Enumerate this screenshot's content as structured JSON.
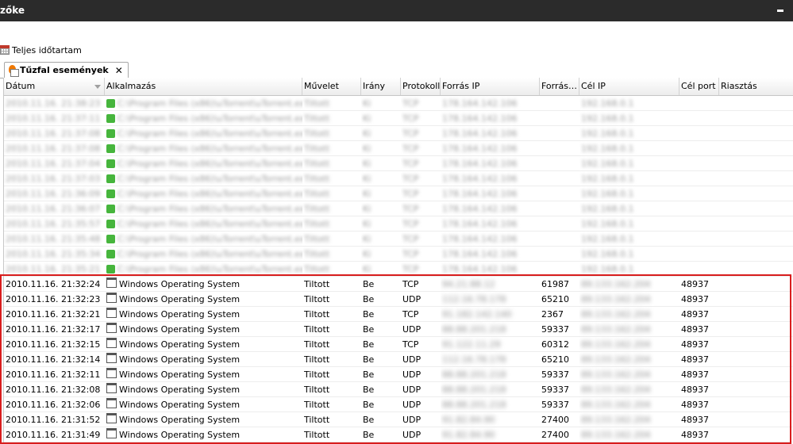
{
  "window": {
    "title": "zőke"
  },
  "period": {
    "label": "Teljes időtartam",
    "icon": "calendar-icon"
  },
  "tab": {
    "label": "Tűzfal események",
    "icon": "firewall-icon",
    "close": "✕"
  },
  "columns": [
    "Dátum",
    "Alkalmazás",
    "Művelet",
    "Irány",
    "Protokoll",
    "Forrás IP",
    "Forrás…",
    "Cél IP",
    "Cél port",
    "Riasztás"
  ],
  "blurred_rows": [
    {
      "date": "2010.11.16. 21:38:23",
      "app": "C:\\Program Files (x86)\\uTorrent\\uTorrent.exe",
      "action": "Tiltott",
      "dir": "Ki",
      "proto": "TCP",
      "src": "178.164.142.106",
      "port": "",
      "dst": "192.168.0.1",
      "dport": ""
    },
    {
      "date": "2010.11.16. 21:37:11",
      "app": "C:\\Program Files (x86)\\uTorrent\\uTorrent.exe",
      "action": "Tiltott",
      "dir": "Ki",
      "proto": "TCP",
      "src": "178.164.142.106",
      "port": "",
      "dst": "192.168.0.1",
      "dport": ""
    },
    {
      "date": "2010.11.16. 21:37:08",
      "app": "C:\\Program Files (x86)\\uTorrent\\uTorrent.exe",
      "action": "Tiltott",
      "dir": "Ki",
      "proto": "TCP",
      "src": "178.164.142.106",
      "port": "",
      "dst": "192.168.0.1",
      "dport": ""
    },
    {
      "date": "2010.11.16. 21:37:08",
      "app": "C:\\Program Files (x86)\\uTorrent\\uTorrent.exe",
      "action": "Tiltott",
      "dir": "Ki",
      "proto": "TCP",
      "src": "178.164.142.106",
      "port": "",
      "dst": "192.168.0.1",
      "dport": ""
    },
    {
      "date": "2010.11.16. 21:37:04",
      "app": "C:\\Program Files (x86)\\uTorrent\\uTorrent.exe",
      "action": "Tiltott",
      "dir": "Ki",
      "proto": "TCP",
      "src": "178.164.142.106",
      "port": "",
      "dst": "192.168.0.1",
      "dport": ""
    },
    {
      "date": "2010.11.16. 21:37:03",
      "app": "C:\\Program Files (x86)\\uTorrent\\uTorrent.exe",
      "action": "Tiltott",
      "dir": "Ki",
      "proto": "TCP",
      "src": "178.164.142.106",
      "port": "",
      "dst": "192.168.0.1",
      "dport": ""
    },
    {
      "date": "2010.11.16. 21:36:09",
      "app": "C:\\Program Files (x86)\\uTorrent\\uTorrent.exe",
      "action": "Tiltott",
      "dir": "Ki",
      "proto": "TCP",
      "src": "178.164.142.106",
      "port": "",
      "dst": "192.168.0.1",
      "dport": ""
    },
    {
      "date": "2010.11.16. 21:36:07",
      "app": "C:\\Program Files (x86)\\uTorrent\\uTorrent.exe",
      "action": "Tiltott",
      "dir": "Ki",
      "proto": "TCP",
      "src": "178.164.142.106",
      "port": "",
      "dst": "192.168.0.1",
      "dport": ""
    },
    {
      "date": "2010.11.16. 21:35:57",
      "app": "C:\\Program Files (x86)\\uTorrent\\uTorrent.exe",
      "action": "Tiltott",
      "dir": "Ki",
      "proto": "TCP",
      "src": "178.164.142.106",
      "port": "",
      "dst": "192.168.0.1",
      "dport": ""
    },
    {
      "date": "2010.11.16. 21:35:48",
      "app": "C:\\Program Files (x86)\\uTorrent\\uTorrent.exe",
      "action": "Tiltott",
      "dir": "Ki",
      "proto": "TCP",
      "src": "178.164.142.106",
      "port": "",
      "dst": "192.168.0.1",
      "dport": ""
    },
    {
      "date": "2010.11.16. 21:35:34",
      "app": "C:\\Program Files (x86)\\uTorrent\\uTorrent.exe",
      "action": "Tiltott",
      "dir": "Ki",
      "proto": "TCP",
      "src": "178.164.142.106",
      "port": "",
      "dst": "192.168.0.1",
      "dport": ""
    },
    {
      "date": "2010.11.16. 21:35:21",
      "app": "C:\\Program Files (x86)\\uTorrent\\uTorrent.exe",
      "action": "Tiltott",
      "dir": "Ki",
      "proto": "TCP",
      "src": "178.164.142.106",
      "port": "",
      "dst": "192.168.0.1",
      "dport": ""
    }
  ],
  "rows": [
    {
      "date": "2010.11.16. 21:32:24",
      "app": "Windows Operating System",
      "action": "Tiltott",
      "dir": "Be",
      "proto": "TCP",
      "src": "94.21.88.12",
      "port": "61987",
      "dst": "89.133.162.204",
      "dport": "48937"
    },
    {
      "date": "2010.11.16. 21:32:23",
      "app": "Windows Operating System",
      "action": "Tiltott",
      "dir": "Be",
      "proto": "UDP",
      "src": "112.16.78.178",
      "port": "65210",
      "dst": "89.133.162.204",
      "dport": "48937"
    },
    {
      "date": "2010.11.16. 21:32:21",
      "app": "Windows Operating System",
      "action": "Tiltott",
      "dir": "Be",
      "proto": "TCP",
      "src": "91.182.142.140",
      "port": "2367",
      "dst": "89.133.162.204",
      "dport": "48937"
    },
    {
      "date": "2010.11.16. 21:32:17",
      "app": "Windows Operating System",
      "action": "Tiltott",
      "dir": "Be",
      "proto": "UDP",
      "src": "88.88.201.218",
      "port": "59337",
      "dst": "89.133.162.204",
      "dport": "48937"
    },
    {
      "date": "2010.11.16. 21:32:15",
      "app": "Windows Operating System",
      "action": "Tiltott",
      "dir": "Be",
      "proto": "TCP",
      "src": "91.122.11.29",
      "port": "60312",
      "dst": "89.133.162.204",
      "dport": "48937"
    },
    {
      "date": "2010.11.16. 21:32:14",
      "app": "Windows Operating System",
      "action": "Tiltott",
      "dir": "Be",
      "proto": "UDP",
      "src": "112.16.78.178",
      "port": "65210",
      "dst": "89.133.162.204",
      "dport": "48937"
    },
    {
      "date": "2010.11.16. 21:32:11",
      "app": "Windows Operating System",
      "action": "Tiltott",
      "dir": "Be",
      "proto": "UDP",
      "src": "88.88.201.218",
      "port": "59337",
      "dst": "89.133.162.204",
      "dport": "48937"
    },
    {
      "date": "2010.11.16. 21:32:08",
      "app": "Windows Operating System",
      "action": "Tiltott",
      "dir": "Be",
      "proto": "UDP",
      "src": "88.88.201.218",
      "port": "59337",
      "dst": "89.133.162.204",
      "dport": "48937"
    },
    {
      "date": "2010.11.16. 21:32:06",
      "app": "Windows Operating System",
      "action": "Tiltott",
      "dir": "Be",
      "proto": "UDP",
      "src": "88.88.201.218",
      "port": "59337",
      "dst": "89.133.162.204",
      "dport": "48937"
    },
    {
      "date": "2010.11.16. 21:31:52",
      "app": "Windows Operating System",
      "action": "Tiltott",
      "dir": "Be",
      "proto": "UDP",
      "src": "91.82.84.90",
      "port": "27400",
      "dst": "89.133.162.204",
      "dport": "48937"
    },
    {
      "date": "2010.11.16. 21:31:49",
      "app": "Windows Operating System",
      "action": "Tiltott",
      "dir": "Be",
      "proto": "UDP",
      "src": "91.82.84.90",
      "port": "27400",
      "dst": "89.133.162.204",
      "dport": "48937"
    }
  ]
}
